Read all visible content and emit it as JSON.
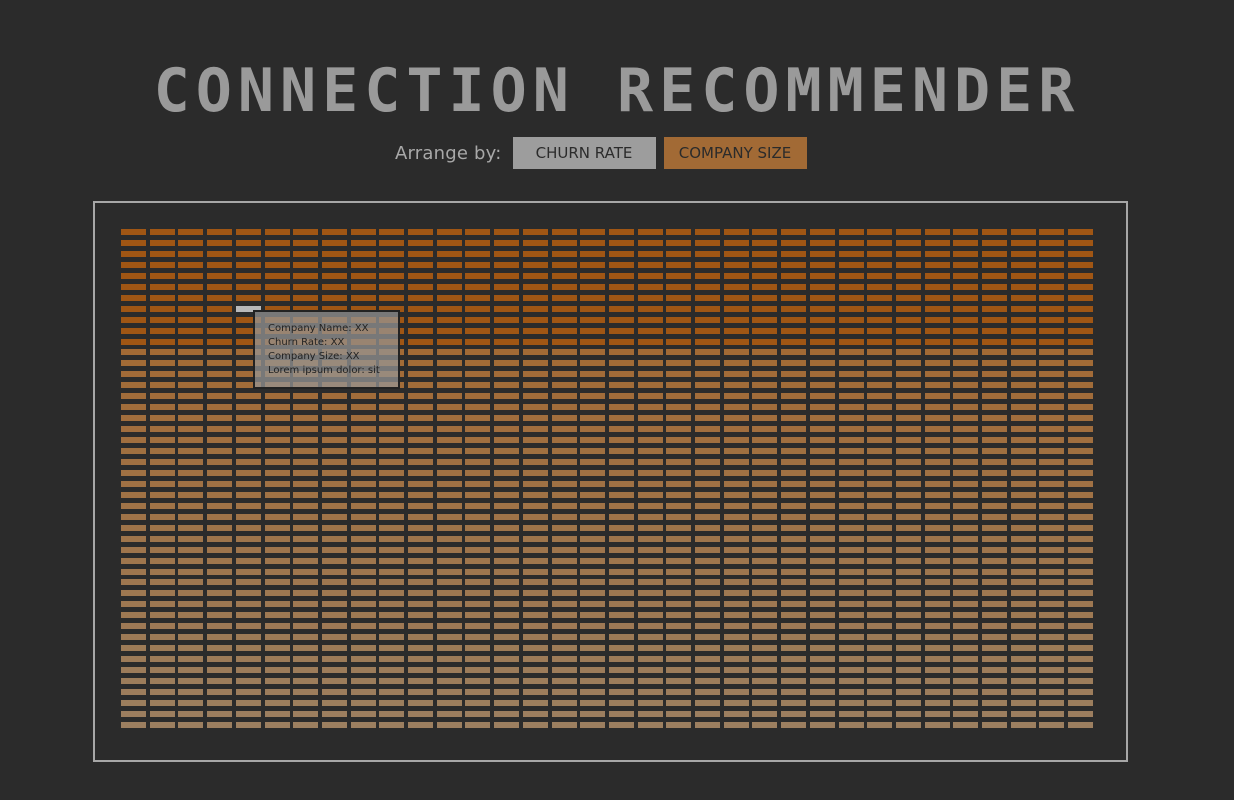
{
  "title": "CONNECTION RECOMMENDER",
  "arrange": {
    "label": "Arrange by:",
    "options": [
      "CHURN RATE",
      "COMPANY SIZE"
    ],
    "active": "COMPANY SIZE"
  },
  "grid": {
    "columns": 34,
    "rows": 46,
    "colors": {
      "dark": "#a05614",
      "mid": "#a26a35",
      "light": "#9c7f60",
      "selected": "#b9b9b9"
    }
  },
  "tooltip": {
    "lines": [
      "Company Name: XX",
      "Churn Rate: XX",
      "Company Size: XX",
      "Lorem ipsum dolor: sit"
    ]
  }
}
